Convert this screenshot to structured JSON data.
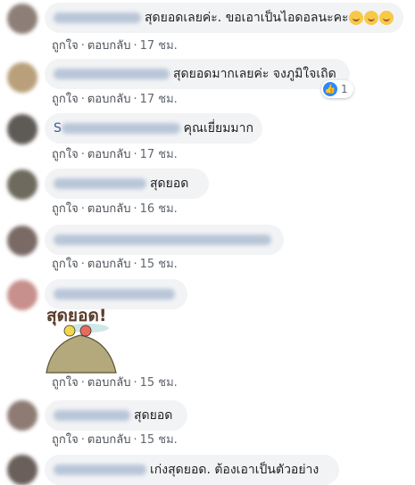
{
  "actions": {
    "like": "ถูกใจ",
    "reply": "ตอบกลับ",
    "separator": "·"
  },
  "comments": [
    {
      "text": "สุดยอดเลยค่ะ. ขอเอาเป็นไอดอลนะคะ",
      "emoji": [
        "smiling-face-icon",
        "smiling-face-icon",
        "smiling-face-icon"
      ],
      "time": "17 ชม."
    },
    {
      "text": "สุดยอดมากเลยค่ะ จงภูมิใจเถิด",
      "time": "17 ชม.",
      "reaction_count": "1"
    },
    {
      "name_initial": "S",
      "text": "คุณเยี่ยมมาก",
      "time": "17 ชม."
    },
    {
      "text": "สุดยอด",
      "time": "16 ชม."
    },
    {
      "text": "",
      "time": "15 ชม."
    },
    {
      "text": "",
      "sticker_text": "สุดยอด!",
      "time": "15 ชม."
    },
    {
      "text": "สุดยอด",
      "time": "15 ชม."
    },
    {
      "text": "เก่งสุดยอด. ต้องเอาเป็นตัวอย่าง"
    }
  ],
  "colors": {
    "bubble": "#f2f3f5",
    "action_text": "#606770",
    "like_blue": "#2d88ff"
  }
}
